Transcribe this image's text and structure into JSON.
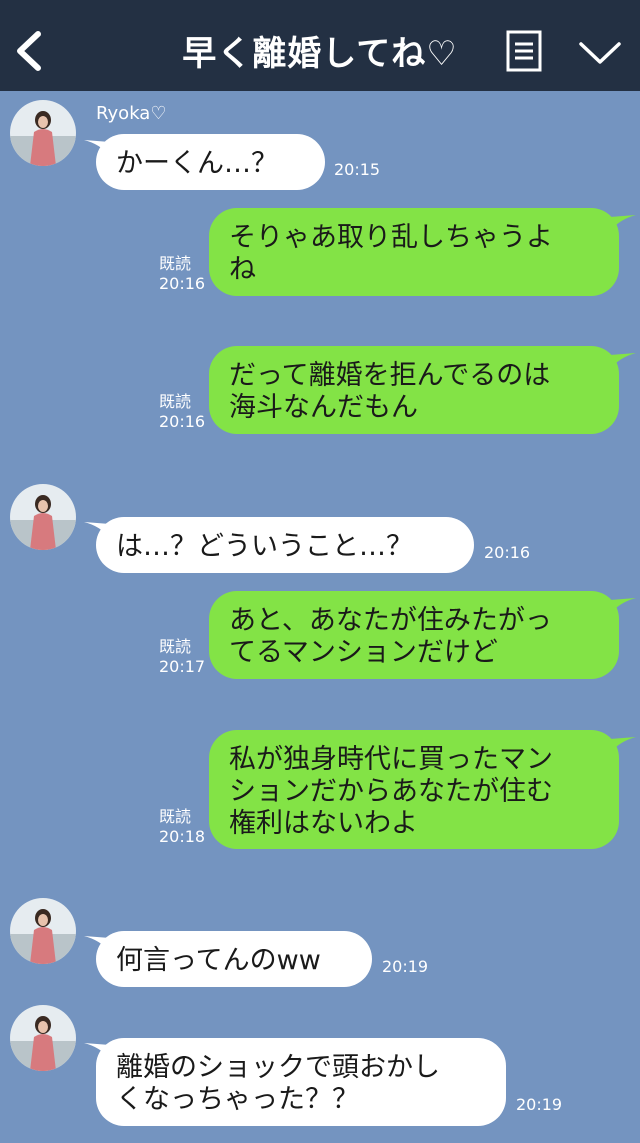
{
  "header": {
    "title": "早く離婚してね♡",
    "back_icon": "chevron-left-icon",
    "menu_icon": "list-icon",
    "collapse_icon": "chevron-down-icon",
    "background": "#233043"
  },
  "chat": {
    "background": "#7494c0",
    "incoming_bubble_color": "#ffffff",
    "outgoing_bubble_color": "#83e346",
    "sender_name": "Ryoka♡",
    "read_label": "既読",
    "messages": [
      {
        "from": "them",
        "text": "かーくん…？",
        "time": "20:15"
      },
      {
        "from": "me",
        "text": "そりゃあ取り乱しちゃうよ\nね",
        "time": "20:16",
        "read": "既読"
      },
      {
        "from": "me",
        "text": "だって離婚を拒んでるのは\n海斗なんだもん",
        "time": "20:16",
        "read": "既読"
      },
      {
        "from": "them",
        "text": "は…？どういうこと…？",
        "time": "20:16"
      },
      {
        "from": "me",
        "text": "あと、あなたが住みたがっ\nてるマンションだけど",
        "time": "20:17",
        "read": "既読"
      },
      {
        "from": "me",
        "text": "私が独身時代に買ったマン\nションだからあなたが住む\n権利はないわよ",
        "time": "20:18",
        "read": "既読"
      },
      {
        "from": "them",
        "text": "何言ってんのww",
        "time": "20:19"
      },
      {
        "from": "them",
        "text": "離婚のショックで頭おかし\nくなっちゃった？？",
        "time": "20:19"
      }
    ]
  }
}
